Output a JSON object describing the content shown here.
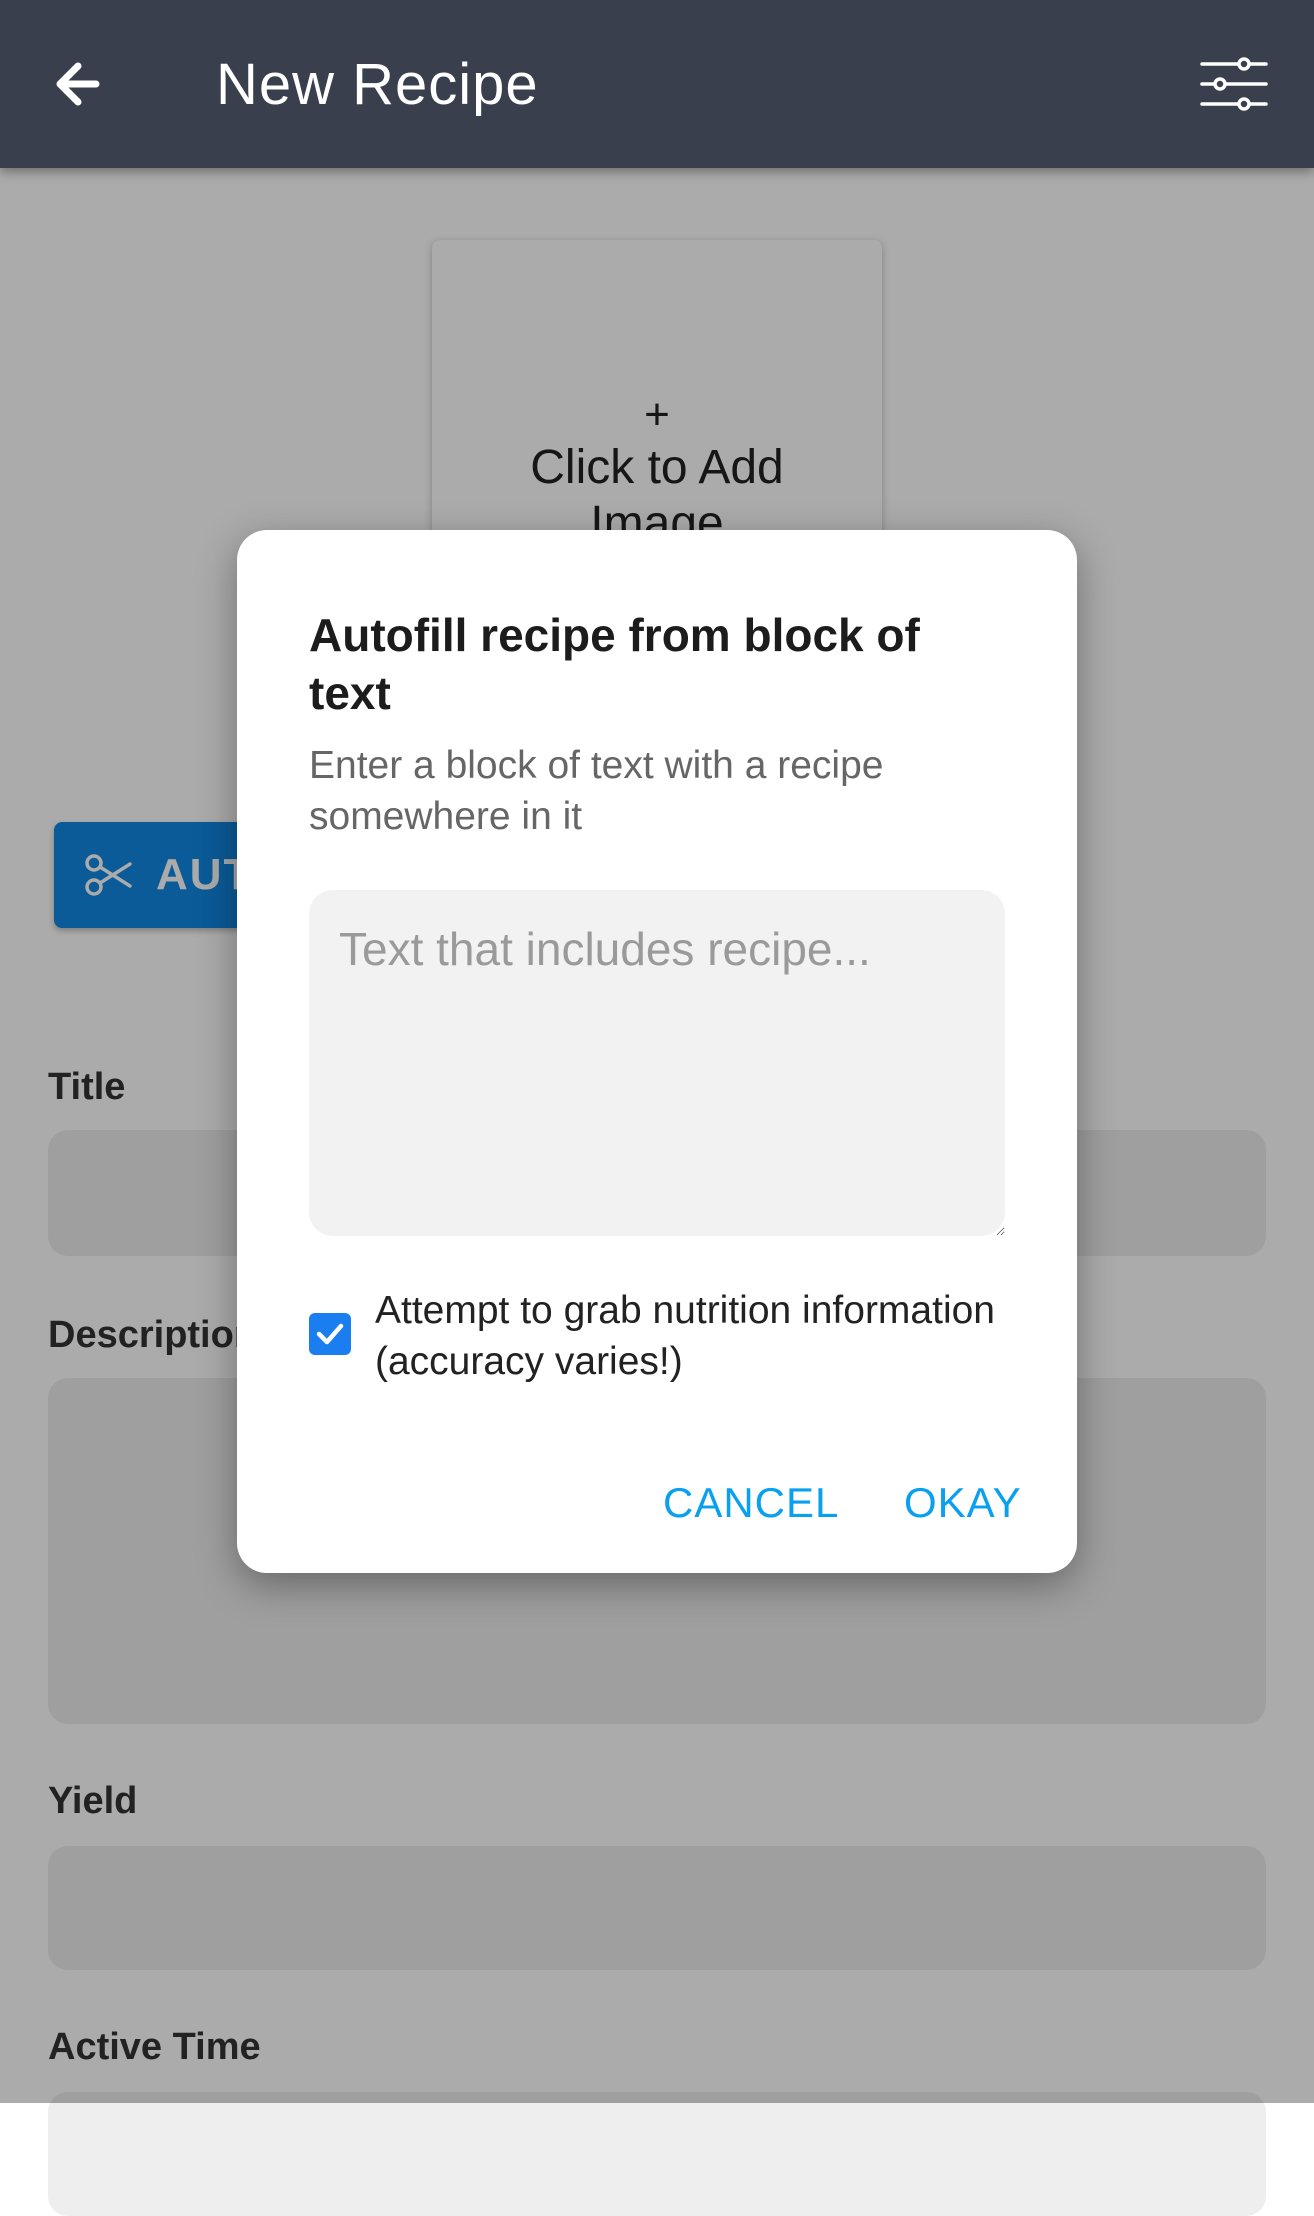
{
  "header": {
    "title": "New Recipe",
    "back_icon": "arrow-left-icon",
    "filter_icon": "sliders-icon",
    "background": "#3a3f4e"
  },
  "image_upload": {
    "plus": "+",
    "label": "Click to Add Image"
  },
  "autofill_button": {
    "icon": "scissors-icon",
    "label": "AUTOFILL",
    "color": "#0f88e3"
  },
  "form": {
    "title_label": "Title",
    "description_label": "Description",
    "yield_label": "Yield",
    "active_time_label": "Active Time"
  },
  "dialog": {
    "title": "Autofill recipe from block of text",
    "subtitle": "Enter a block of text with a recipe somewhere in it",
    "textarea_placeholder": "Text that includes recipe...",
    "checkbox_checked": true,
    "checkbox_label": "Attempt to grab nutrition information (accuracy varies!)",
    "cancel_label": "CANCEL",
    "okay_label": "OKAY",
    "accent_color": "#0aa0f0"
  }
}
